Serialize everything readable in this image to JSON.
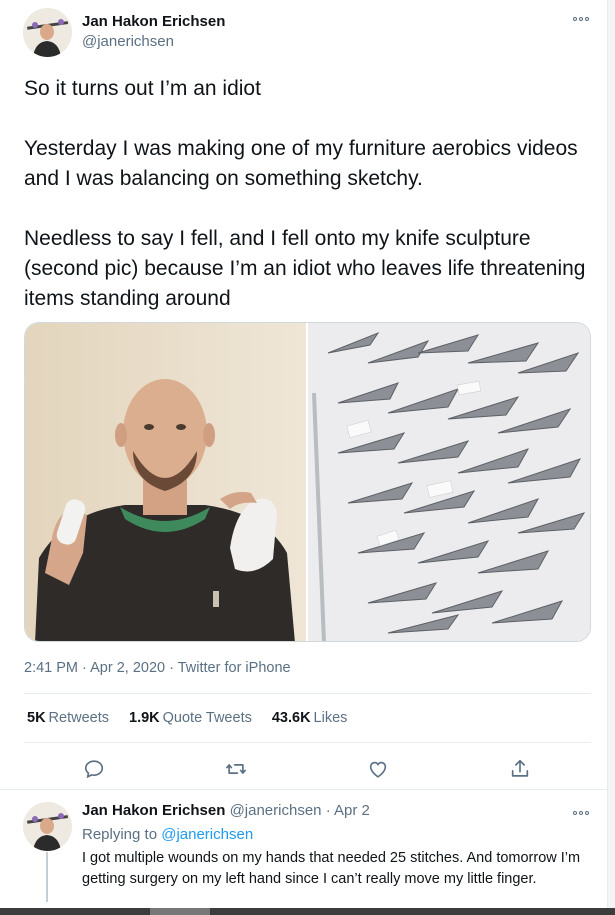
{
  "tweet": {
    "author_name": "Jan Hakon Erichsen",
    "author_handle": "@janerichsen",
    "text": "So it turns out I’m an idiot\n\nYesterday I was making one of my furniture aerobics videos and I was balancing on something sketchy.\n\nNeedless to say I fell, and I fell onto my knife sculpture (second pic) because I’m an idiot who leaves life threatening items standing around",
    "time": "2:41 PM",
    "date": "Apr 2, 2020",
    "separator": "·",
    "source": "Twitter for iPhone",
    "stats": {
      "retweets_count": "5K",
      "retweets_label": "Retweets",
      "quotes_count": "1.9K",
      "quotes_label": "Quote Tweets",
      "likes_count": "43.6K",
      "likes_label": "Likes"
    },
    "actions": [
      "reply-icon",
      "retweet-icon",
      "like-icon",
      "share-icon"
    ]
  },
  "reply": {
    "author_name": "Jan Hakon Erichsen",
    "author_handle": "@janerichsen",
    "separator": "·",
    "date": "Apr 2",
    "replying_prefix": "Replying to",
    "replying_to": "@janerichsen",
    "text": "I got multiple wounds on my hands that needed 25 stitches. And tomorrow I’m getting surgery on my left hand since I can’t really move my little finger."
  },
  "colors": {
    "text": "#0f1419",
    "secondary": "#5b7083",
    "link": "#1d9bf0",
    "divider": "#e6ecf0"
  }
}
